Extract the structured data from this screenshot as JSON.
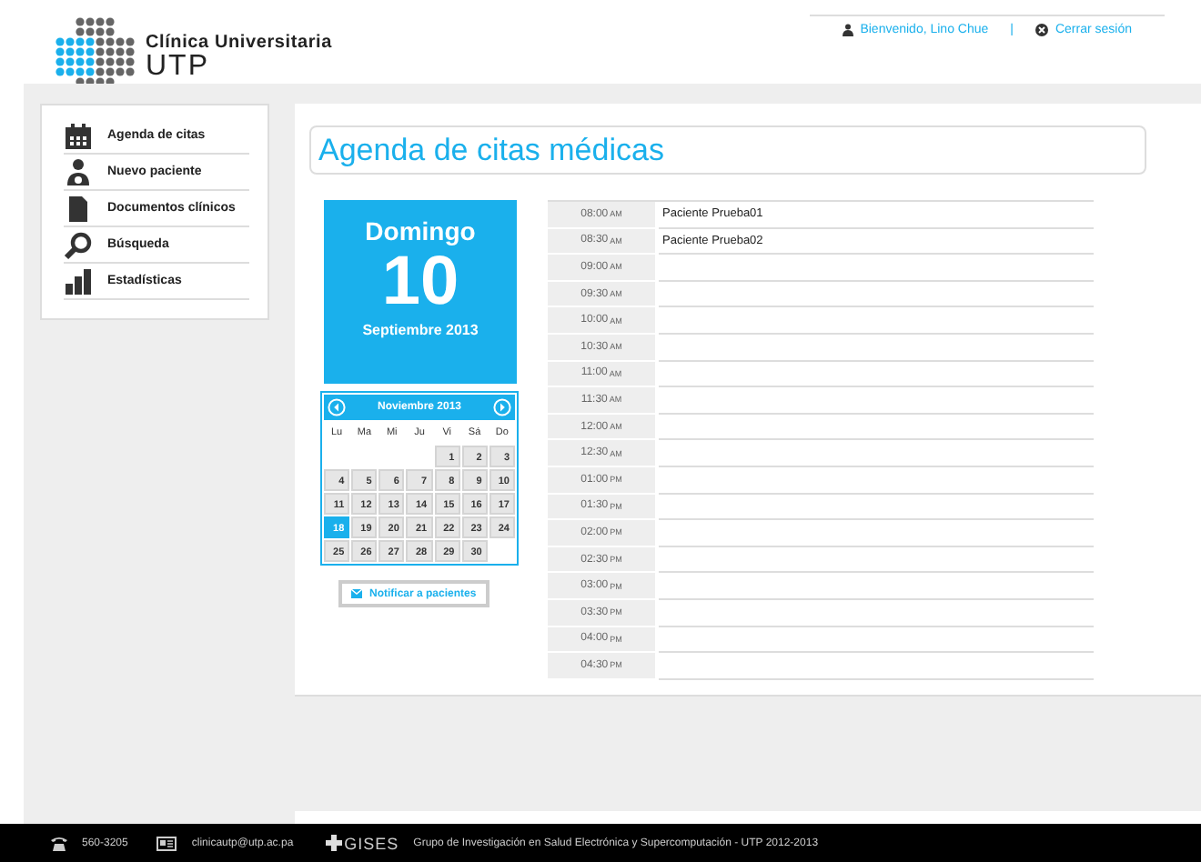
{
  "header": {
    "logo": {
      "line1": "Clínica Universitaria",
      "line2": "UTP"
    },
    "user_menu": [
      {
        "kind": "user",
        "label": "Bienvenido,  Lino Chue"
      },
      {
        "kind": "separator",
        "label": "|"
      },
      {
        "kind": "logout",
        "label": "Cerrar sesión"
      }
    ]
  },
  "sidebar": {
    "items": [
      {
        "kind": "calendar",
        "label": "Agenda de citas"
      },
      {
        "kind": "person",
        "label": "Nuevo paciente"
      },
      {
        "kind": "document",
        "label": "Documentos clínicos"
      },
      {
        "kind": "search",
        "label": "Búsqueda"
      },
      {
        "kind": "chart",
        "label": "Estadísticas"
      }
    ]
  },
  "page_title": "Agenda de citas médicas",
  "day_card": {
    "weekday": "Domingo",
    "day": "10",
    "month_year": "Septiembre 2013"
  },
  "calendar": {
    "title": "Noviembre 2013",
    "weekdays": [
      "Lu",
      "Ma",
      "Mi",
      "Ju",
      "Vi",
      "Sá",
      "Do"
    ],
    "weeks": [
      {
        "kind": "first",
        "days": [
          {
            "label": "1",
            "selected": false
          },
          {
            "label": "2",
            "selected": false
          },
          {
            "label": "3",
            "selected": false
          }
        ]
      },
      {
        "kind": "full",
        "days": [
          {
            "label": "4",
            "selected": false
          },
          {
            "label": "5",
            "selected": false
          },
          {
            "label": "6",
            "selected": false
          },
          {
            "label": "7",
            "selected": false
          },
          {
            "label": "8",
            "selected": false
          },
          {
            "label": "9",
            "selected": false
          },
          {
            "label": "10",
            "selected": false
          }
        ]
      },
      {
        "kind": "full",
        "days": [
          {
            "label": "11",
            "selected": false
          },
          {
            "label": "12",
            "selected": false
          },
          {
            "label": "13",
            "selected": false
          },
          {
            "label": "14",
            "selected": false
          },
          {
            "label": "15",
            "selected": false
          },
          {
            "label": "16",
            "selected": false
          },
          {
            "label": "17",
            "selected": false
          }
        ]
      },
      {
        "kind": "full",
        "days": [
          {
            "label": "18",
            "selected": true
          },
          {
            "label": "19",
            "selected": false
          },
          {
            "label": "20",
            "selected": false
          },
          {
            "label": "21",
            "selected": false
          },
          {
            "label": "22",
            "selected": false
          },
          {
            "label": "23",
            "selected": false
          },
          {
            "label": "24",
            "selected": false
          }
        ]
      },
      {
        "kind": "last",
        "days": [
          {
            "label": "25",
            "selected": false
          },
          {
            "label": "26",
            "selected": false
          },
          {
            "label": "27",
            "selected": false
          },
          {
            "label": "28",
            "selected": false
          },
          {
            "label": "29",
            "selected": false
          },
          {
            "label": "30",
            "selected": false
          }
        ]
      }
    ]
  },
  "notify_button": "Notificar a pacientes",
  "schedule": {
    "rows": [
      {
        "time": "08:00",
        "period": "AM",
        "patient": "Paciente Prueba01"
      },
      {
        "time": "08:30",
        "period": "AM",
        "patient": "Paciente Prueba02"
      },
      {
        "time": "09:00",
        "period": "AM"
      },
      {
        "time": "09:30",
        "period": "AM"
      },
      {
        "time": "10:00",
        "period": "AM"
      },
      {
        "time": "10:30",
        "period": "AM"
      },
      {
        "time": "11:00",
        "period": "AM"
      },
      {
        "time": "11:30",
        "period": "AM"
      },
      {
        "time": "12:00",
        "period": "AM"
      },
      {
        "time": "12:30",
        "period": "AM"
      },
      {
        "time": "01:00",
        "period": "PM"
      },
      {
        "time": "01:30",
        "period": "PM"
      },
      {
        "time": "02:00",
        "period": "PM"
      },
      {
        "time": "02:30",
        "period": "PM"
      },
      {
        "time": "03:00",
        "period": "PM"
      },
      {
        "time": "03:30",
        "period": "PM"
      },
      {
        "time": "04:00",
        "period": "PM"
      },
      {
        "time": "04:30",
        "period": "PM"
      }
    ]
  },
  "footer": {
    "phone": "560-3205",
    "email": "clinicautp@utp.ac.pa",
    "group_logo": "GISES",
    "group_name": "Grupo de Investigación en Salud Electrónica y Supercomputación - UTP 2012-2013"
  }
}
